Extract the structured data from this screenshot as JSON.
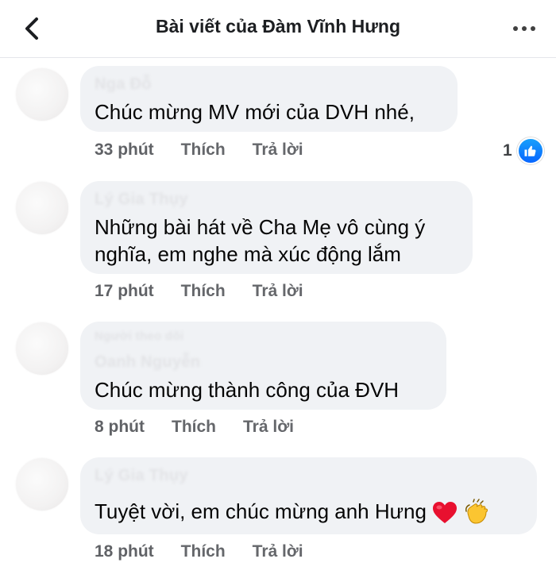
{
  "header": {
    "title": "Bài viết của Đàm Vĩnh Hưng",
    "back_icon": "chevron-left-icon",
    "more_icon": "more-horizontal-icon"
  },
  "comments": [
    {
      "author": "Nga Đỗ",
      "text": "Chúc mừng MV mới của DVH nhé,",
      "time": "33 phút",
      "like_label": "Thích",
      "reply_label": "Trả lời",
      "reaction_count": "1",
      "reaction_icon": "like-icon"
    },
    {
      "author": "Lý Gia Thụy",
      "text_line1": "Những bài hát về Cha Mẹ vô cùng ý",
      "text_line2": "nghĩa, em nghe mà xúc động lắm",
      "time": "17 phút",
      "like_label": "Thích",
      "reply_label": "Trả lời"
    },
    {
      "author_top": "Người theo dõi",
      "author": "Oanh Nguyễn",
      "text": "Chúc mừng thành công của ĐVH",
      "time": "8 phút",
      "like_label": "Thích",
      "reply_label": "Trả lời"
    },
    {
      "author": "Lý Gia Thụy",
      "text": "Tuyệt vời, em chúc mừng anh Hưng",
      "emojis": [
        "red-heart-icon",
        "clapping-hands-icon"
      ],
      "time": "18 phút",
      "like_label": "Thích",
      "reply_label": "Trả lời"
    }
  ],
  "colors": {
    "bubble": "#f0f2f5",
    "meta_text": "#65676b",
    "like_blue": "#0866ff",
    "heart_red": "#e8102f",
    "clap_yellow": "#fbc531"
  }
}
